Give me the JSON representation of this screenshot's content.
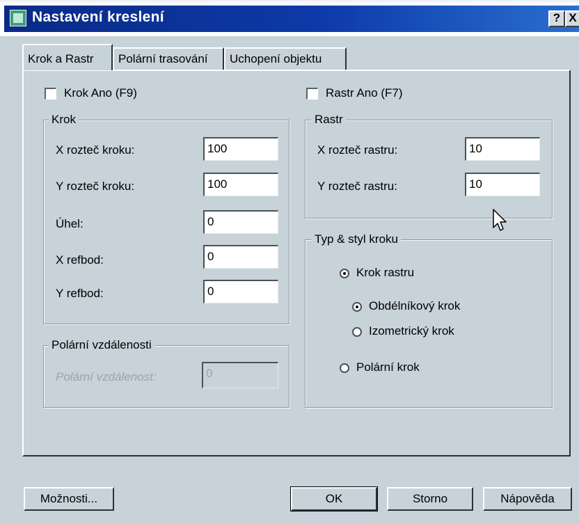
{
  "window": {
    "title": "Nastavení kreslení",
    "help_glyph": "?",
    "close_glyph": "X"
  },
  "tabs": [
    {
      "label": "Krok a Rastr",
      "active": true
    },
    {
      "label": "Polární trasování",
      "active": false
    },
    {
      "label": "Uchopení objektu",
      "active": false
    }
  ],
  "snap_on": {
    "label": "Krok Ano (F9)",
    "checked": false
  },
  "grid_on": {
    "label": "Rastr Ano (F7)",
    "checked": false
  },
  "snap": {
    "title": "Krok",
    "rows": [
      {
        "label": "X rozteč kroku:",
        "value": "100"
      },
      {
        "label": "Y rozteč kroku:",
        "value": "100"
      },
      {
        "label": "Úhel:",
        "value": "0"
      },
      {
        "label": "X refbod:",
        "value": "0"
      },
      {
        "label": "Y refbod:",
        "value": "0"
      }
    ]
  },
  "polar_distance": {
    "title": "Polární vzdálenosti",
    "label": "Polární vzdálenost:",
    "value": "0",
    "enabled": false
  },
  "grid": {
    "title": "Rastr",
    "rows": [
      {
        "label": "X rozteč rastru:",
        "value": "10"
      },
      {
        "label": "Y rozteč rastru:",
        "value": "10"
      }
    ]
  },
  "snap_type": {
    "title": "Typ & styl kroku",
    "grid_snap": {
      "label": "Krok rastru",
      "selected": true
    },
    "rectangular": {
      "label": "Obdélníkový krok",
      "selected": true
    },
    "isometric": {
      "label": "Izometrický krok",
      "selected": false
    },
    "polar": {
      "label": "Polární krok",
      "selected": false
    }
  },
  "buttons": {
    "options": "Možnosti...",
    "ok": "OK",
    "cancel": "Storno",
    "help": "Nápověda"
  },
  "colors": {
    "title_bar": "#0a2a86",
    "dialog_bg": "#c7d2d9"
  },
  "icons": {
    "app": "app-icon",
    "cursor": "mouse-pointer-icon"
  }
}
